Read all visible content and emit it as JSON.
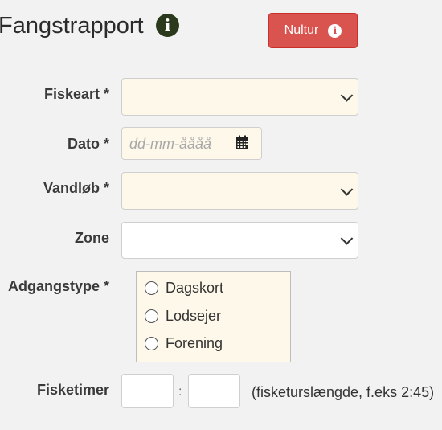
{
  "header": {
    "title": "Fangstrapport",
    "info_icon": "info-icon",
    "nultur_button": {
      "label": "Nultur",
      "icon": "info-icon"
    }
  },
  "form": {
    "fiskeart": {
      "label": "Fiskeart *",
      "value": ""
    },
    "dato": {
      "label": "Dato *",
      "placeholder": "dd-mm-åååå",
      "icon": "calendar-icon"
    },
    "vandlob": {
      "label": "Vandløb *",
      "value": ""
    },
    "zone": {
      "label": "Zone",
      "value": ""
    },
    "adgangstype": {
      "label": "Adgangstype *",
      "options": [
        "Dagskort",
        "Lodsejer",
        "Forening"
      ]
    },
    "fisketimer": {
      "label": "Fisketimer",
      "separator": ":",
      "hint": "(fisketurslængde, f.eks 2:45)"
    }
  },
  "colors": {
    "required_field_bg": "#fdf8ea",
    "danger_button": "#d9534f",
    "info_icon_bg": "#2b3a1c"
  }
}
